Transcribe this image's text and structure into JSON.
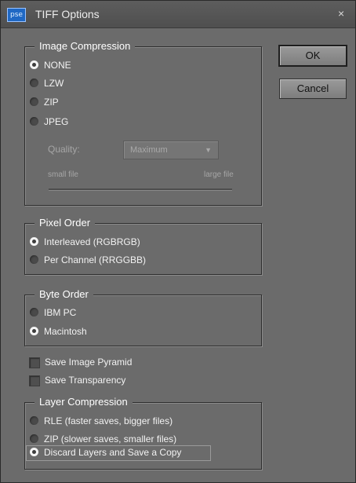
{
  "window": {
    "icon_text": "pse",
    "title": "TIFF Options",
    "close_label": "×"
  },
  "buttons": {
    "ok": "OK",
    "cancel": "Cancel"
  },
  "image_compression": {
    "legend": "Image Compression",
    "options": [
      {
        "label": "NONE",
        "selected": true
      },
      {
        "label": "LZW",
        "selected": false
      },
      {
        "label": "ZIP",
        "selected": false
      },
      {
        "label": "JPEG",
        "selected": false
      }
    ],
    "quality_label": "Quality:",
    "quality_value": "Maximum",
    "small_file_label": "small file",
    "large_file_label": "large file"
  },
  "pixel_order": {
    "legend": "Pixel Order",
    "options": [
      {
        "label": "Interleaved (RGBRGB)",
        "selected": true
      },
      {
        "label": "Per Channel (RRGGBB)",
        "selected": false
      }
    ]
  },
  "byte_order": {
    "legend": "Byte Order",
    "options": [
      {
        "label": "IBM PC",
        "selected": false
      },
      {
        "label": "Macintosh",
        "selected": true
      }
    ]
  },
  "checkboxes": {
    "save_pyramid": {
      "label": "Save Image Pyramid",
      "checked": false
    },
    "save_transparency": {
      "label": "Save Transparency",
      "checked": false
    }
  },
  "layer_compression": {
    "legend": "Layer Compression",
    "options": [
      {
        "label": "RLE (faster saves, bigger files)",
        "selected": false
      },
      {
        "label": "ZIP (slower saves, smaller files)",
        "selected": false
      },
      {
        "label": "Discard Layers and Save a Copy",
        "selected": true
      }
    ]
  }
}
